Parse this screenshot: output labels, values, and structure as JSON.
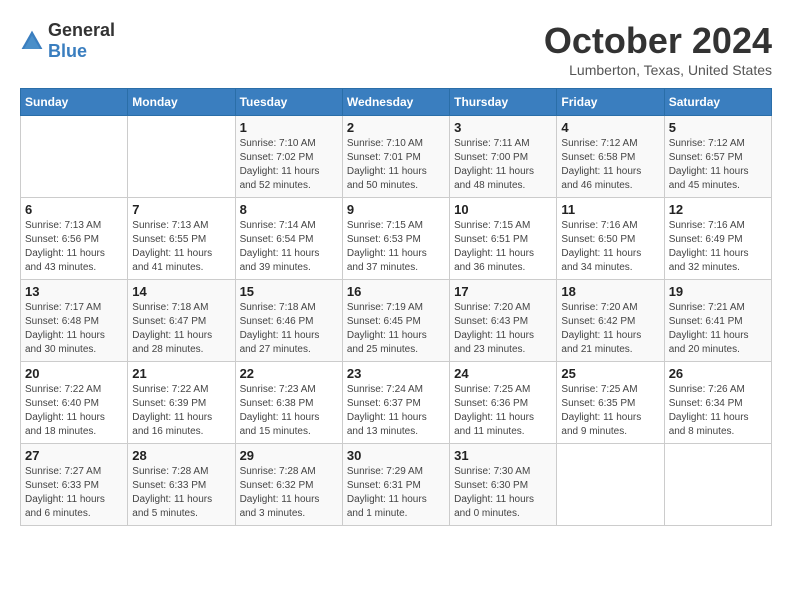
{
  "header": {
    "logo_general": "General",
    "logo_blue": "Blue",
    "month_title": "October 2024",
    "location": "Lumberton, Texas, United States"
  },
  "days_of_week": [
    "Sunday",
    "Monday",
    "Tuesday",
    "Wednesday",
    "Thursday",
    "Friday",
    "Saturday"
  ],
  "weeks": [
    [
      {
        "day": "",
        "info": ""
      },
      {
        "day": "",
        "info": ""
      },
      {
        "day": "1",
        "info": "Sunrise: 7:10 AM\nSunset: 7:02 PM\nDaylight: 11 hours and 52 minutes."
      },
      {
        "day": "2",
        "info": "Sunrise: 7:10 AM\nSunset: 7:01 PM\nDaylight: 11 hours and 50 minutes."
      },
      {
        "day": "3",
        "info": "Sunrise: 7:11 AM\nSunset: 7:00 PM\nDaylight: 11 hours and 48 minutes."
      },
      {
        "day": "4",
        "info": "Sunrise: 7:12 AM\nSunset: 6:58 PM\nDaylight: 11 hours and 46 minutes."
      },
      {
        "day": "5",
        "info": "Sunrise: 7:12 AM\nSunset: 6:57 PM\nDaylight: 11 hours and 45 minutes."
      }
    ],
    [
      {
        "day": "6",
        "info": "Sunrise: 7:13 AM\nSunset: 6:56 PM\nDaylight: 11 hours and 43 minutes."
      },
      {
        "day": "7",
        "info": "Sunrise: 7:13 AM\nSunset: 6:55 PM\nDaylight: 11 hours and 41 minutes."
      },
      {
        "day": "8",
        "info": "Sunrise: 7:14 AM\nSunset: 6:54 PM\nDaylight: 11 hours and 39 minutes."
      },
      {
        "day": "9",
        "info": "Sunrise: 7:15 AM\nSunset: 6:53 PM\nDaylight: 11 hours and 37 minutes."
      },
      {
        "day": "10",
        "info": "Sunrise: 7:15 AM\nSunset: 6:51 PM\nDaylight: 11 hours and 36 minutes."
      },
      {
        "day": "11",
        "info": "Sunrise: 7:16 AM\nSunset: 6:50 PM\nDaylight: 11 hours and 34 minutes."
      },
      {
        "day": "12",
        "info": "Sunrise: 7:16 AM\nSunset: 6:49 PM\nDaylight: 11 hours and 32 minutes."
      }
    ],
    [
      {
        "day": "13",
        "info": "Sunrise: 7:17 AM\nSunset: 6:48 PM\nDaylight: 11 hours and 30 minutes."
      },
      {
        "day": "14",
        "info": "Sunrise: 7:18 AM\nSunset: 6:47 PM\nDaylight: 11 hours and 28 minutes."
      },
      {
        "day": "15",
        "info": "Sunrise: 7:18 AM\nSunset: 6:46 PM\nDaylight: 11 hours and 27 minutes."
      },
      {
        "day": "16",
        "info": "Sunrise: 7:19 AM\nSunset: 6:45 PM\nDaylight: 11 hours and 25 minutes."
      },
      {
        "day": "17",
        "info": "Sunrise: 7:20 AM\nSunset: 6:43 PM\nDaylight: 11 hours and 23 minutes."
      },
      {
        "day": "18",
        "info": "Sunrise: 7:20 AM\nSunset: 6:42 PM\nDaylight: 11 hours and 21 minutes."
      },
      {
        "day": "19",
        "info": "Sunrise: 7:21 AM\nSunset: 6:41 PM\nDaylight: 11 hours and 20 minutes."
      }
    ],
    [
      {
        "day": "20",
        "info": "Sunrise: 7:22 AM\nSunset: 6:40 PM\nDaylight: 11 hours and 18 minutes."
      },
      {
        "day": "21",
        "info": "Sunrise: 7:22 AM\nSunset: 6:39 PM\nDaylight: 11 hours and 16 minutes."
      },
      {
        "day": "22",
        "info": "Sunrise: 7:23 AM\nSunset: 6:38 PM\nDaylight: 11 hours and 15 minutes."
      },
      {
        "day": "23",
        "info": "Sunrise: 7:24 AM\nSunset: 6:37 PM\nDaylight: 11 hours and 13 minutes."
      },
      {
        "day": "24",
        "info": "Sunrise: 7:25 AM\nSunset: 6:36 PM\nDaylight: 11 hours and 11 minutes."
      },
      {
        "day": "25",
        "info": "Sunrise: 7:25 AM\nSunset: 6:35 PM\nDaylight: 11 hours and 9 minutes."
      },
      {
        "day": "26",
        "info": "Sunrise: 7:26 AM\nSunset: 6:34 PM\nDaylight: 11 hours and 8 minutes."
      }
    ],
    [
      {
        "day": "27",
        "info": "Sunrise: 7:27 AM\nSunset: 6:33 PM\nDaylight: 11 hours and 6 minutes."
      },
      {
        "day": "28",
        "info": "Sunrise: 7:28 AM\nSunset: 6:33 PM\nDaylight: 11 hours and 5 minutes."
      },
      {
        "day": "29",
        "info": "Sunrise: 7:28 AM\nSunset: 6:32 PM\nDaylight: 11 hours and 3 minutes."
      },
      {
        "day": "30",
        "info": "Sunrise: 7:29 AM\nSunset: 6:31 PM\nDaylight: 11 hours and 1 minute."
      },
      {
        "day": "31",
        "info": "Sunrise: 7:30 AM\nSunset: 6:30 PM\nDaylight: 11 hours and 0 minutes."
      },
      {
        "day": "",
        "info": ""
      },
      {
        "day": "",
        "info": ""
      }
    ]
  ]
}
